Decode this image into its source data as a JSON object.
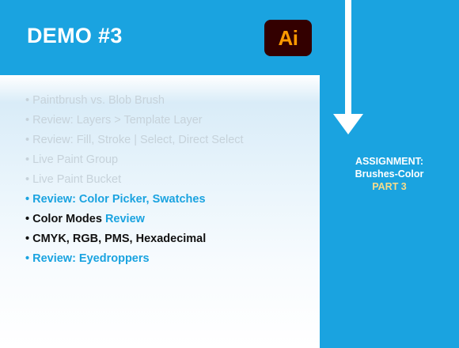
{
  "header": {
    "title": "DEMO #3"
  },
  "logo": {
    "text": "Ai",
    "background": "#330000",
    "color": "#ff9a00"
  },
  "bullets": [
    {
      "text": "• Paintbrush vs. Blob Brush"
    },
    {
      "text": "• Review: Layers > Template Layer"
    },
    {
      "text": "• Review: Fill, Stroke | Select, Direct Select"
    },
    {
      "text": "• Live Paint Group"
    },
    {
      "text": "• Live Paint Bucket"
    },
    {
      "text": "• Review: Color Picker, Swatches"
    },
    {
      "text": "• Color Modes ",
      "suffix": "Review"
    },
    {
      "text": "• CMYK, RGB, PMS, Hexadecimal"
    },
    {
      "text": "• Review: Eyedroppers"
    }
  ],
  "assignment": {
    "line1": "ASSIGNMENT:",
    "line2": "Brushes-Color",
    "line3": "PART 3"
  },
  "colors": {
    "accent_blue": "#1aa3e0",
    "faded_text": "#c6d2da",
    "highlight_text": "#111111",
    "part_label": "#f6dc8c"
  }
}
